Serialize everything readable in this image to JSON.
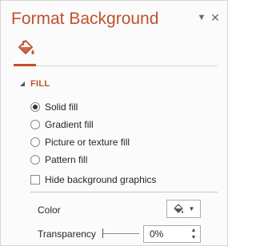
{
  "pane": {
    "title": "Format Background",
    "menu_icon": "dropdown-arrow-icon",
    "close_icon": "close-icon",
    "tab_icon": "paint-bucket-icon"
  },
  "fill_section": {
    "label": "FILL",
    "expand_icon": "collapse-triangle-icon",
    "options": [
      {
        "label": "Solid fill",
        "selected": true
      },
      {
        "label": "Gradient fill",
        "selected": false
      },
      {
        "label": "Picture or texture fill",
        "selected": false
      },
      {
        "label": "Pattern fill",
        "selected": false
      }
    ],
    "hide_background": {
      "label": "Hide background graphics",
      "checked": false
    },
    "color": {
      "label": "Color",
      "icon": "paint-bucket-icon"
    },
    "transparency": {
      "label": "Transparency",
      "value": "0%",
      "level": 0
    }
  },
  "colors": {
    "accent": "#c1502e",
    "text": "#262626"
  }
}
